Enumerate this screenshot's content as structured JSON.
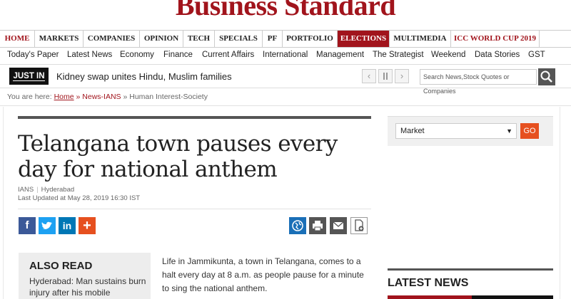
{
  "brand": {
    "logo_text": "Business Standard",
    "brand_color": "#a1141c",
    "accent_color": "#e6501f"
  },
  "primary_nav": [
    {
      "label": "HOME"
    },
    {
      "label": "MARKETS"
    },
    {
      "label": "COMPANIES"
    },
    {
      "label": "OPINION"
    },
    {
      "label": "TECH"
    },
    {
      "label": "SPECIALS"
    },
    {
      "label": "PF"
    },
    {
      "label": "PORTFOLIO"
    },
    {
      "label": "ELECTIONS"
    },
    {
      "label": "MULTIMEDIA"
    },
    {
      "label": "ICC WORLD CUP 2019"
    }
  ],
  "secondary_nav": [
    {
      "label": "Today's Paper"
    },
    {
      "label": "Latest News"
    },
    {
      "label": "Economy"
    },
    {
      "label": "Finance"
    },
    {
      "label": "Current Affairs"
    },
    {
      "label": "International"
    },
    {
      "label": "Management"
    },
    {
      "label": "The Strategist"
    },
    {
      "label": "Weekend"
    },
    {
      "label": "Data Stories"
    },
    {
      "label": "GST"
    }
  ],
  "ticker": {
    "badge": "JUST IN",
    "headline": "Kidney swap unites Hindu, Muslim families",
    "prev_icon": "chevron-left-icon",
    "pause_icon": "pause-icon",
    "next_icon": "chevron-right-icon"
  },
  "search": {
    "placeholder": "Search News,Stock Quotes or Companies",
    "icon": "search-icon"
  },
  "breadcrumb": {
    "prefix": "You are here:",
    "home": "Home",
    "sep1": "»",
    "section": "News-IANS",
    "sep2": "»",
    "current": "Human Interest-Society"
  },
  "article": {
    "headline": "Telangana town pauses every day for national anthem",
    "agency": "IANS",
    "location": "Hyderabad",
    "updated": "Last Updated at May 28, 2019 16:30 IST",
    "body": "Life in Jammikunta, a town in Telangana, comes to a halt every day at 8 a.m. as people pause for a minute to sing the national anthem."
  },
  "share": [
    {
      "name": "facebook-icon",
      "glyph": "f",
      "color": "#3b5998"
    },
    {
      "name": "twitter-icon",
      "glyph": "t",
      "color": "#1da1f2"
    },
    {
      "name": "linkedin-icon",
      "glyph": "in",
      "color": "#0077b5"
    },
    {
      "name": "more-icon",
      "glyph": "+",
      "color": "#e6501f"
    }
  ],
  "tools": [
    {
      "name": "globe-icon"
    },
    {
      "name": "print-icon"
    },
    {
      "name": "email-icon"
    },
    {
      "name": "save-document-icon"
    }
  ],
  "also_read": {
    "title": "ALSO READ",
    "item": "Hyderabad: Man sustains burn injury after his mobile"
  },
  "sidebar": {
    "select_value": "Market",
    "go_label": "GO",
    "latest_title": "LATEST NEWS"
  }
}
